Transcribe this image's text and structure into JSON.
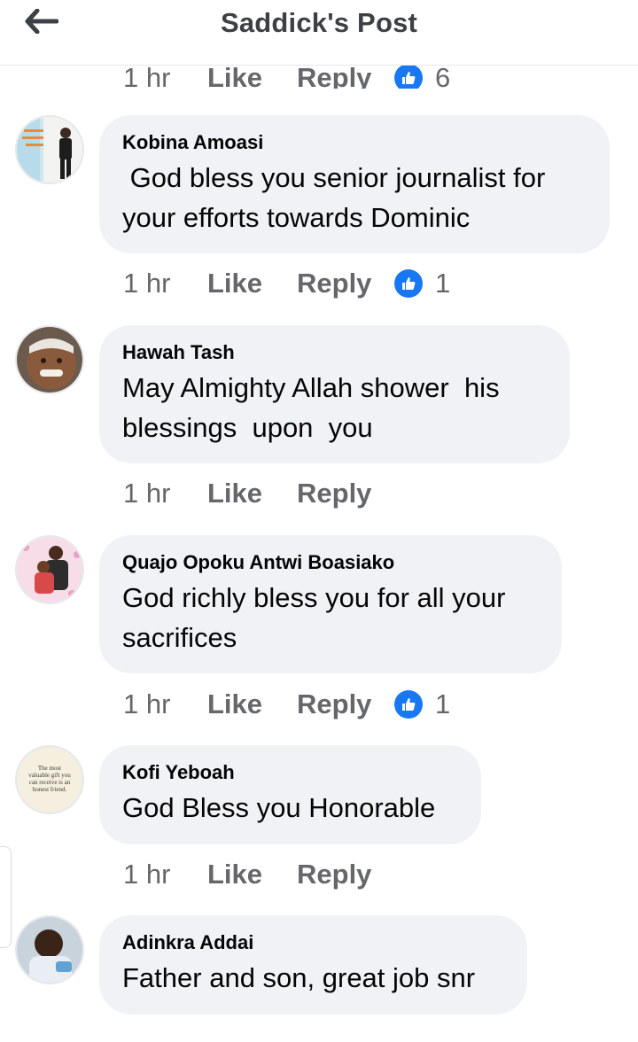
{
  "header": {
    "title": "Saddick's Post",
    "back_icon": "arrow-left-icon"
  },
  "colors": {
    "accent": "#1877f2",
    "bubble": "#f0f2f5",
    "meta_text": "#65676b"
  },
  "previous_comment_meta": {
    "time": "1 hr",
    "like": "Like",
    "reply": "Reply",
    "reaction_icon": "thumbs-up-icon",
    "reaction_count": "6"
  },
  "comments": [
    {
      "author": "Kobina Amoasi",
      "text": " God bless you senior journalist for\nyour efforts towards Dominic",
      "time": "1 hr",
      "like": "Like",
      "reply": "Reply",
      "reaction_icon": "thumbs-up-icon",
      "reaction_count": "1"
    },
    {
      "author": "Hawah Tash",
      "text": "May Almighty Allah shower  his\nblessings  upon  you",
      "time": "1 hr",
      "like": "Like",
      "reply": "Reply"
    },
    {
      "author": "Quajo Opoku Antwi Boasiako",
      "text": "God richly bless you for all your\nsacrifices",
      "time": "1 hr",
      "like": "Like",
      "reply": "Reply",
      "reaction_icon": "thumbs-up-icon",
      "reaction_count": "1"
    },
    {
      "author": "Kofi Yeboah",
      "text": "God Bless you Honorable",
      "time": "1 hr",
      "like": "Like",
      "reply": "Reply",
      "avatar_text": "The most\nvaluable gift you\ncan receive is an\nhonest friend."
    },
    {
      "author": "Adinkra Addai",
      "text": "Father and son, great job snr"
    }
  ]
}
